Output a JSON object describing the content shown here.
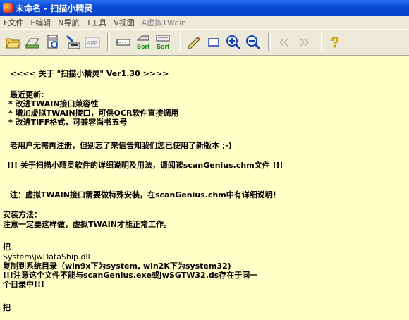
{
  "window": {
    "title": "未命名 - 扫描小精灵"
  },
  "menu": [
    {
      "label": "F文件",
      "enabled": true
    },
    {
      "label": "E编辑",
      "enabled": true
    },
    {
      "label": "N导航",
      "enabled": true
    },
    {
      "label": "T工具",
      "enabled": true
    },
    {
      "label": "V视图",
      "enabled": true
    },
    {
      "label": "A虚拟TWain",
      "enabled": false
    }
  ],
  "toolbar": {
    "sort_label": "Sort",
    "app_label": "APP",
    "icons": [
      "open-icon",
      "scanner-icon",
      "preview-icon",
      "acquire-icon",
      "app-icon",
      "crop-icon",
      "sort-icon",
      "sort-all-icon",
      "pencil-icon",
      "rectangle-icon",
      "zoom-in-icon",
      "zoom-out-icon",
      "prev-icon",
      "next-icon",
      "help-icon"
    ]
  },
  "document": {
    "header": "<<<< 关于 \"扫描小精灵\" Ver1.30 >>>>",
    "update_title": "最近更新:",
    "updates": [
      "* 改进TWAIN接口兼容性",
      "* 增加虚拟TWAIN接口，可供OCR软件直接调用",
      "* 改进TIFF格式，可兼容尚书五号"
    ],
    "free_note": "老用户无需再注册，但别忘了来信告知我们您已使用了新版本 ;-)",
    "doc_note": "!!! 关于扫描小精灵软件的详细说明及用法，请阅读scanGenius.chm文件 !!!",
    "twain_note": "注：虚拟TWAIN接口需要做特殊安装，在scanGenius.chm中有详细说明！",
    "install_title": "安装方法：",
    "install_lines": [
      "注意一定要这样做，虚拟TWAIN才能正常工作。",
      "把",
      "System\\jwDataShip.dll",
      "复制到系统目录（win9x下为system, win2K下为system32)",
      "!!!注意这个文件不能与scanGenius.exe或jwSGTW32.ds存在于同一",
      "个目录中!!!",
      "把"
    ]
  }
}
